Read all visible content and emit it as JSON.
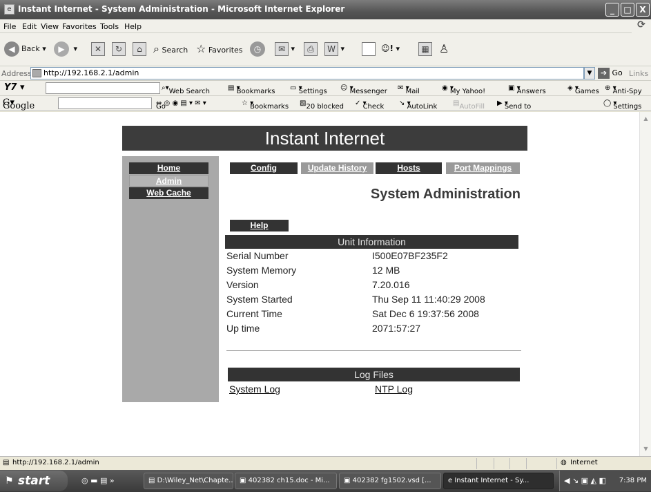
{
  "window": {
    "title": "Instant Internet - System Administration - Microsoft Internet Explorer",
    "controls": [
      "_",
      "□",
      "X"
    ]
  },
  "menu": [
    "File",
    "Edit",
    "View",
    "Favorites",
    "Tools",
    "Help"
  ],
  "toolbar": {
    "back": "Back",
    "search": "Search",
    "favorites": "Favorites"
  },
  "address": {
    "label": "Address",
    "url": "http://192.168.2.1/admin",
    "go": "Go",
    "links": "Links"
  },
  "yahoo_toolbar": {
    "web_search": "Web Search",
    "items": [
      "Bookmarks",
      "Settings",
      "Messenger",
      "Mail",
      "My Yahoo!",
      "Answers",
      "Games",
      "Anti-Spy"
    ]
  },
  "google_toolbar": {
    "logo": "Google",
    "go": "Go",
    "items": [
      "Bookmarks",
      "20 blocked",
      "Check",
      "AutoLink",
      "AutoFill",
      "Send to",
      "Settings"
    ]
  },
  "page": {
    "banner": "Instant Internet",
    "nav": [
      "Home",
      "Admin",
      "Web Cache"
    ],
    "tabs": [
      "Config",
      "Update History",
      "Hosts",
      "Port Mappings"
    ],
    "title": "System Administration",
    "help": "Help",
    "unit_info": {
      "heading": "Unit Information",
      "rows": [
        {
          "label": "Serial Number",
          "value": "I500E07BF235F2"
        },
        {
          "label": "System Memory",
          "value": "12 MB"
        },
        {
          "label": "Version",
          "value": "7.20.016"
        },
        {
          "label": "System Started",
          "value": "Thu Sep 11 11:40:29 2008"
        },
        {
          "label": "Current Time",
          "value": "Sat Dec 6 19:37:56 2008"
        },
        {
          "label": "Up time",
          "value": "2071:57:27"
        }
      ]
    },
    "log_files": {
      "heading": "Log Files",
      "links": [
        "System Log",
        "NTP Log"
      ]
    }
  },
  "status": {
    "url": "http://192.168.2.1/admin",
    "zone": "Internet"
  },
  "taskbar": {
    "start": "start",
    "tasks": [
      "D:\\Wiley_Net\\Chapte...",
      "402382 ch15.doc - Mi...",
      "402382 fg1502.vsd [...",
      "Instant Internet - Sy..."
    ],
    "clock": "7:38 PM"
  }
}
